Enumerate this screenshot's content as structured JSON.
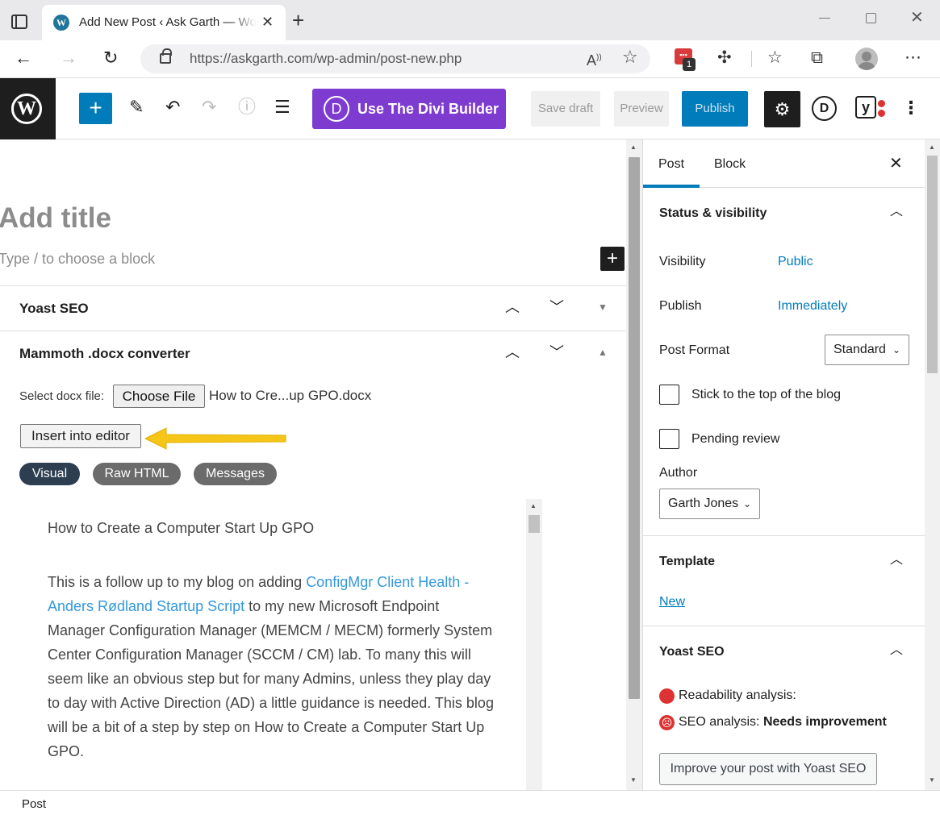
{
  "browser": {
    "tab_title": "Add New Post ‹ Ask Garth — WordPress",
    "url": "https://askgarth.com/wp-admin/post-new.php",
    "extension_badge": "1",
    "icons": {
      "favicon": "wordpress-icon",
      "back": "←",
      "forward": "→",
      "reload": "↻",
      "close": "✕",
      "new_tab": "+",
      "read_aloud": "A͡",
      "favorites": "☆",
      "extensions": "puzzle-icon",
      "more": "⋯"
    }
  },
  "wp_header": {
    "divi_label": "Use The Divi Builder",
    "divi_letter": "D",
    "save_draft": "Save draft",
    "preview": "Preview",
    "publish": "Publish",
    "yoast_letter": "y"
  },
  "editor": {
    "title_placeholder": "Add title",
    "block_placeholder": "Type / to choose a block",
    "metaboxes": [
      {
        "title": "Yoast SEO"
      },
      {
        "title": "Mammoth .docx converter"
      }
    ],
    "mammoth": {
      "select_label": "Select docx file:",
      "choose_file": "Choose File",
      "file_name": "How to Cre...up GPO.docx",
      "insert_button": "Insert into editor",
      "tabs": [
        "Visual",
        "Raw HTML",
        "Messages"
      ],
      "preview_title": "How to Create a Computer Start Up GPO",
      "preview_text_before": "This is a follow up to my blog on adding ",
      "preview_link": "ConfigMgr Client Health - Anders Rødland Startup Script",
      "preview_text_after": " to my new Microsoft Endpoint Manager Configuration Manager (MEMCM / MECM) formerly System Center Configuration Manager (SCCM / CM) lab. To many this will seem like an obvious step but for many Admins, unless they play day to day with Active Direction (AD) a little guidance is needed. This blog will be a bit of a step by step on How to Create a Computer Start Up GPO."
    }
  },
  "sidebar": {
    "tabs": [
      "Post",
      "Block"
    ],
    "status": {
      "title": "Status & visibility",
      "visibility_label": "Visibility",
      "visibility_value": "Public",
      "publish_label": "Publish",
      "publish_value": "Immediately",
      "format_label": "Post Format",
      "format_value": "Standard",
      "stick_label": "Stick to the top of the blog",
      "pending_label": "Pending review",
      "author_label": "Author",
      "author_value": "Garth Jones"
    },
    "template": {
      "title": "Template",
      "link": "New"
    },
    "yoast": {
      "title": "Yoast SEO",
      "readability": "Readability analysis:",
      "seo_label": "SEO analysis: ",
      "seo_value": "Needs improvement",
      "improve_button": "Improve your post with Yoast SEO"
    }
  },
  "footer": {
    "breadcrumb": "Post"
  },
  "colors": {
    "wp_blue": "#007cba",
    "divi_purple": "#7e3bd0",
    "yoast_red": "#dc3232",
    "arrow_yellow": "#f5c518",
    "pill_visual": "#2c3e50",
    "pill_inactive": "#6b6b6b"
  }
}
